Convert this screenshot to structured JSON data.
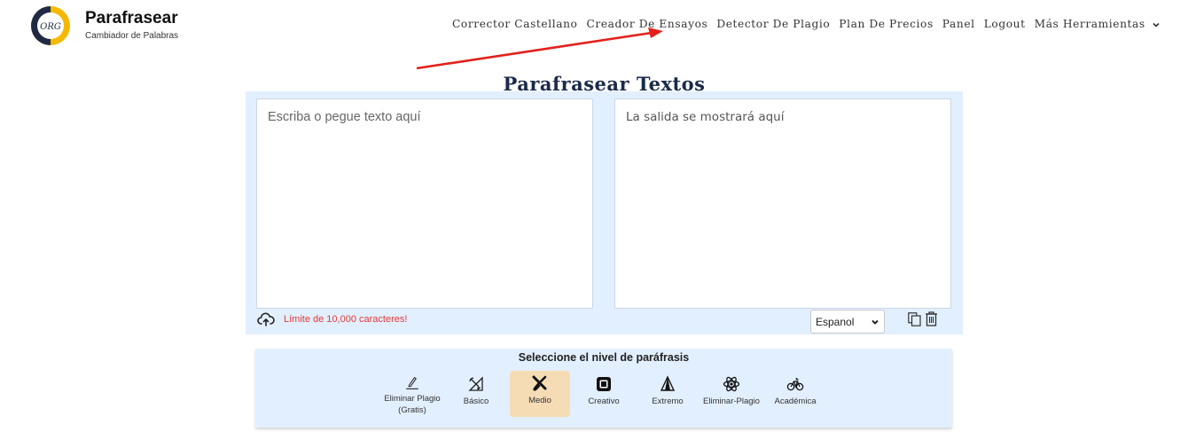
{
  "brand": {
    "logo_text": "ORG",
    "title": "Parafrasear",
    "subtitle": "Cambiador de Palabras"
  },
  "nav": {
    "items": [
      "Corrector Castellano",
      "Creador De Ensayos",
      "Detector De Plagio",
      "Plan De Precios",
      "Panel",
      "Logout",
      "Más Herramientas"
    ]
  },
  "page": {
    "title": "Parafrasear Textos"
  },
  "editor": {
    "input_placeholder": "Escriba o pegue texto aquí",
    "output_placeholder": "La salida se mostrará aquí",
    "limit_text": "Límite de 10,000 caracteres!",
    "language": "Espanol"
  },
  "levels": {
    "title": "Seleccione el nivel de paráfrasis",
    "items": [
      {
        "label_line1": "Eliminar Plagio",
        "label_line2": "(Gratis)",
        "icon": "pen-icon"
      },
      {
        "label_line1": "Básico",
        "label_line2": "",
        "icon": "tools-icon"
      },
      {
        "label_line1": "Medio",
        "label_line2": "",
        "icon": "brush-icon",
        "active": true
      },
      {
        "label_line1": "Creativo",
        "label_line2": "",
        "icon": "frame-icon"
      },
      {
        "label_line1": "Extremo",
        "label_line2": "",
        "icon": "sail-icon"
      },
      {
        "label_line1": "Eliminar-Plagio",
        "label_line2": "",
        "icon": "atom-icon"
      },
      {
        "label_line1": "Académica",
        "label_line2": "",
        "icon": "bicycle-icon"
      }
    ]
  },
  "colors": {
    "accent": "#f5b800",
    "panel_bg": "#e2efff",
    "active_level": "#f6dcb5",
    "limit_red": "#e53935",
    "arrow_red": "#e3201b"
  }
}
